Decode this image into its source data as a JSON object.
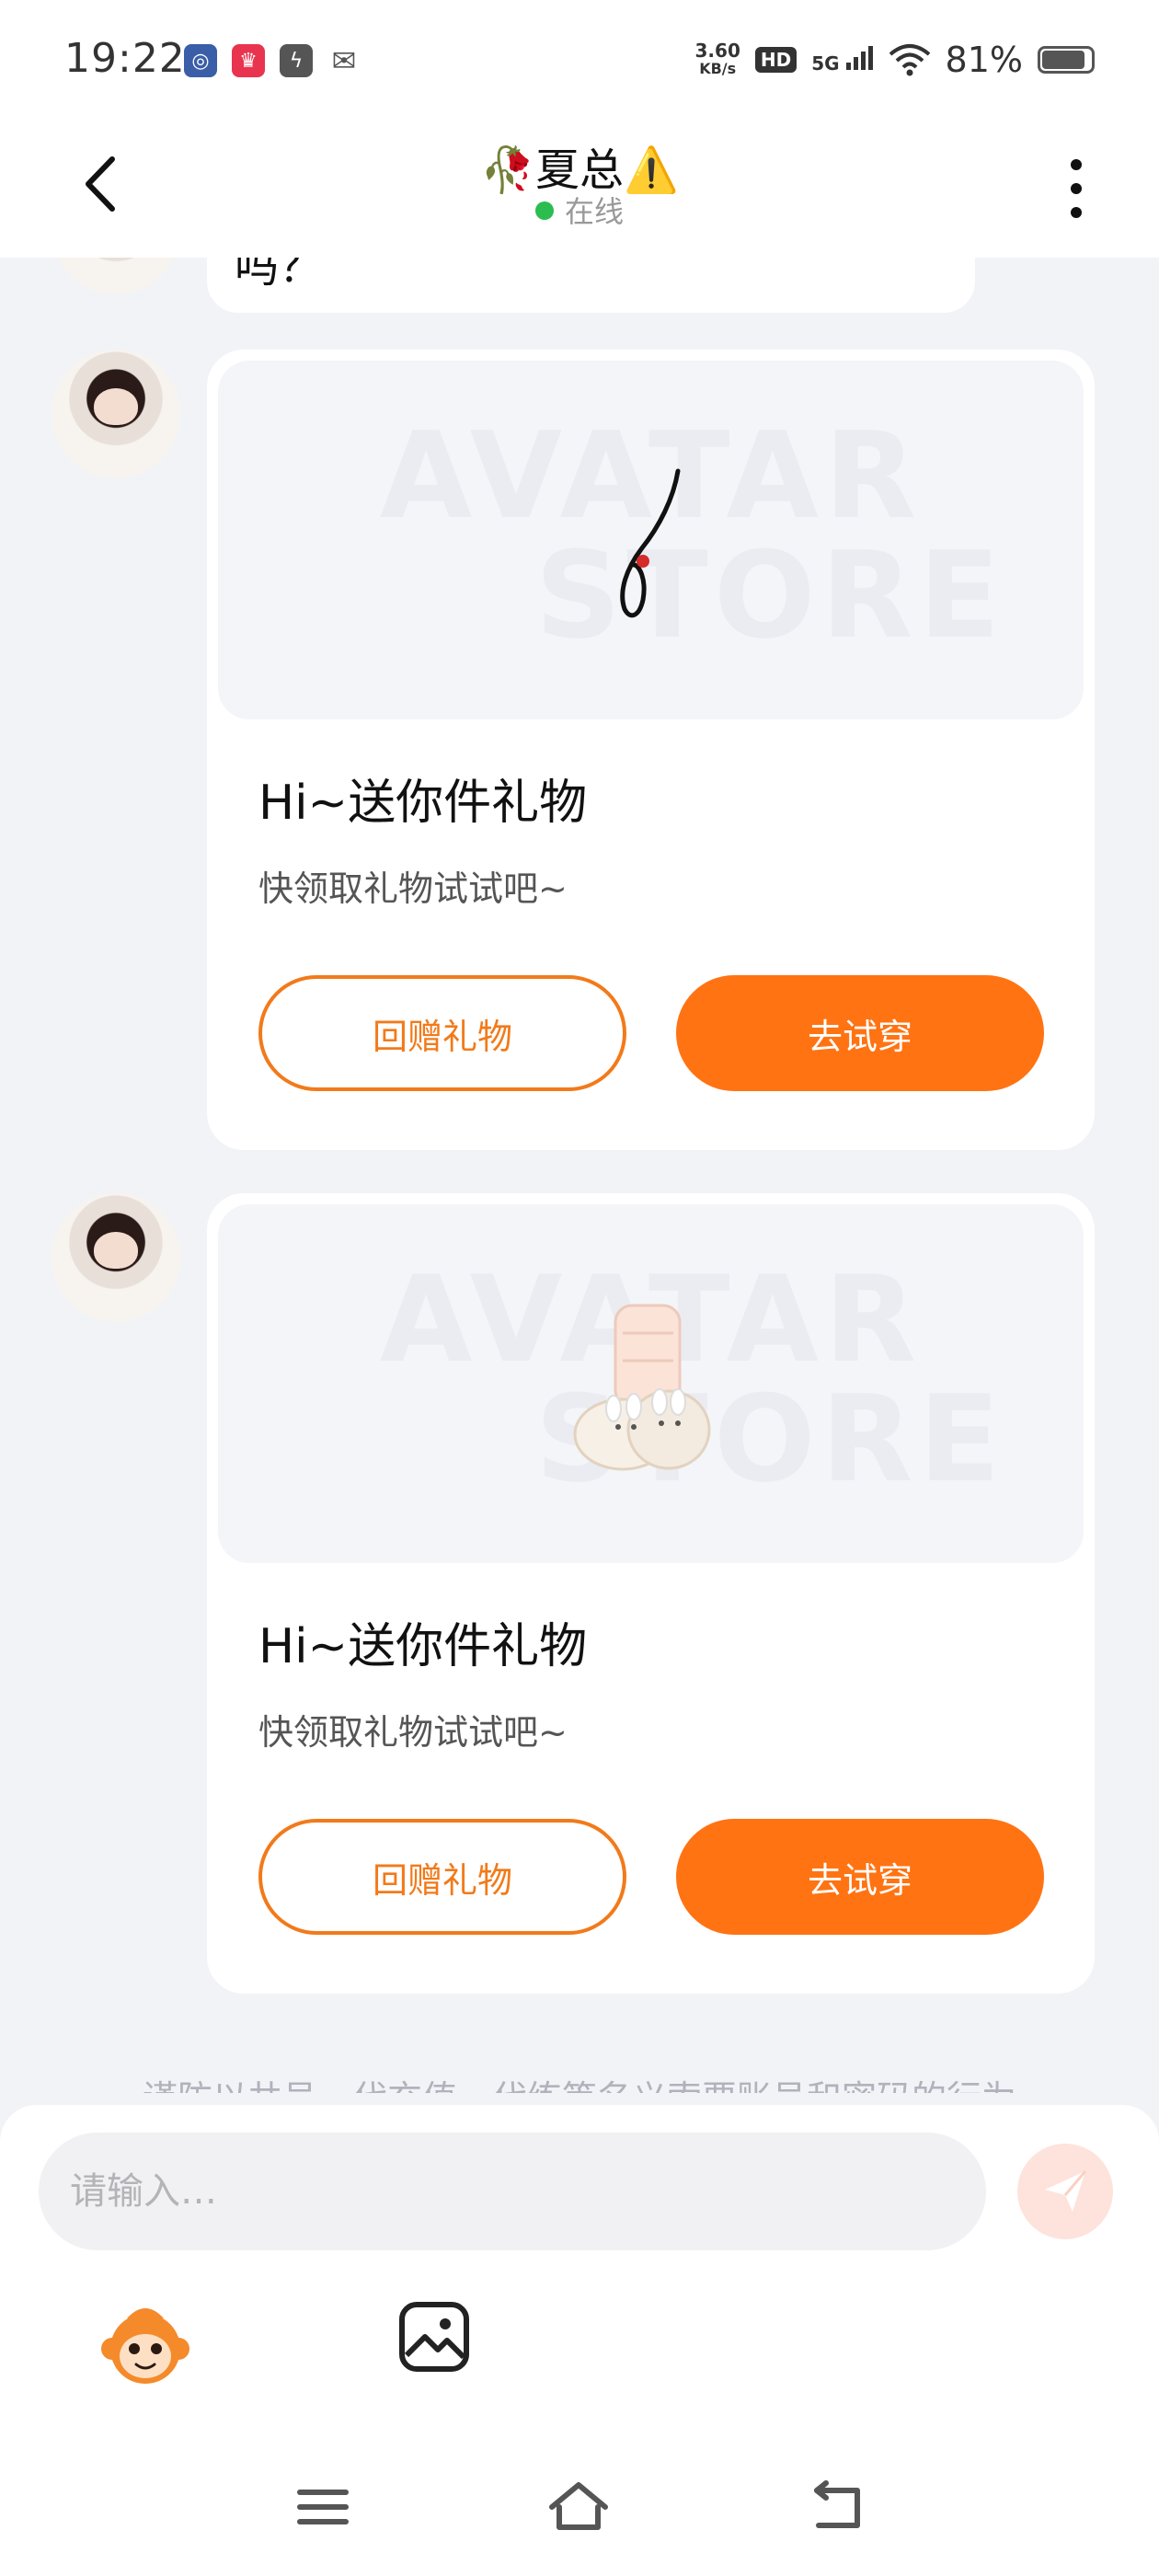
{
  "status_bar": {
    "time": "19:22",
    "net_speed_value": "3.60",
    "net_speed_unit": "KB/s",
    "hd_label": "HD",
    "signal_label": "5G",
    "battery": "81%"
  },
  "header": {
    "title": "🥀夏总⚠️",
    "status": "在线"
  },
  "messages": {
    "partial_text": "吗？",
    "cards": [
      {
        "watermark_line1": "AVATAR",
        "watermark_line2": "STORE",
        "title": "Hi~送你件礼物",
        "subtitle": "快领取礼物试试吧~",
        "return_gift_label": "回赠礼物",
        "try_on_label": "去试穿",
        "item_icon": "necklace-icon"
      },
      {
        "watermark_line1": "AVATAR",
        "watermark_line2": "STORE",
        "title": "Hi~送你件礼物",
        "subtitle": "快领取礼物试试吧~",
        "return_gift_label": "回赠礼物",
        "try_on_label": "去试穿",
        "item_icon": "bunny-slippers-icon"
      }
    ],
    "notice": "谨防以共号、代充值、代练等名义索要账号和密码的行为"
  },
  "composer": {
    "placeholder": "请输入…",
    "value": ""
  },
  "colors": {
    "accent": "#ff7313",
    "online": "#2bbd4f",
    "background": "#f2f3f7"
  }
}
